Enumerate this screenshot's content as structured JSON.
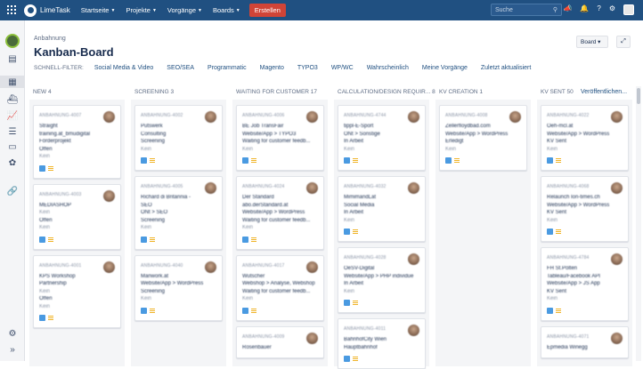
{
  "app": {
    "name": "LimeTask"
  },
  "nav": [
    {
      "label": "Startseite"
    },
    {
      "label": "Projekte"
    },
    {
      "label": "Vorgänge"
    },
    {
      "label": "Boards"
    }
  ],
  "create_label": "Erstellen",
  "search_placeholder": "Suche",
  "breadcrumb": "Anbahnung",
  "title": "Kanban-Board",
  "board_button": "Board",
  "filters": {
    "label": "SCHNELL-FILTER:",
    "items": [
      "Social Media & Video",
      "SEO/SEA",
      "Programmatic",
      "Magento",
      "TYPO3",
      "WP/WC",
      "Wahrscheinlich",
      "Meine Vorgänge",
      "Zuletzt aktualisiert"
    ]
  },
  "publish_label": "Veröffentlichen...",
  "columns": [
    {
      "name": "NEW 4",
      "cards": [
        {
          "key": "ANBAHNUNG-4007",
          "lines": [
            "Straight",
            "training.at_bmudigital",
            "Förderprojekt",
            "Offen",
            "Kein"
          ]
        },
        {
          "key": "ANBAHNUNG-4003",
          "lines": [
            "MEDIASHOP",
            "Kein",
            "Offen",
            "Kein"
          ]
        },
        {
          "key": "ANBAHNUNG-4001",
          "lines": [
            "KPS Workshop",
            "Partnership",
            "Kein",
            "Offen",
            "Kein"
          ]
        }
      ]
    },
    {
      "name": "SCREENING 3",
      "cards": [
        {
          "key": "ANBAHNUNG-4002",
          "lines": [
            "Putswerk",
            "Consulting",
            "Screening",
            "Kein"
          ]
        },
        {
          "key": "ANBAHNUNG-4005",
          "lines": [
            "Richard di Britannia -",
            "SEO",
            "ONt > SEO",
            "Screening",
            "Kein"
          ]
        },
        {
          "key": "ANBAHNUNG-4040",
          "lines": [
            "Manwork.at",
            "Website/App > WordPress",
            "Screening",
            "Kein"
          ]
        }
      ]
    },
    {
      "name": "WAITING FOR CUSTOMER 17",
      "cards": [
        {
          "key": "ANBAHNUNG-4006",
          "lines": [
            "BE Job TransFair",
            "Website/App > TYPO3",
            "Waiting for customer feedb...",
            "Kein"
          ]
        },
        {
          "key": "ANBAHNUNG-4024",
          "lines": [
            "Der Standard",
            "abo.derStandard.at",
            "Website/App > WordPress",
            "Waiting for customer feedb...",
            "Kein"
          ]
        },
        {
          "key": "ANBAHNUNG-4017",
          "lines": [
            "Wutscher",
            "Webshop > Analyse, Webshop",
            "Waiting for customer feedb...",
            "Kein"
          ]
        },
        {
          "key": "ANBAHNUNG-4009",
          "lines": [
            "Rosenbauer"
          ]
        }
      ]
    },
    {
      "name": "CALCULATION/DESIGN REQUIR... 8",
      "cards": [
        {
          "key": "ANBAHNUNG-4744",
          "lines": [
            "tippl-E-Sport",
            "ONt > Sonstige",
            "In Arbeit",
            "Kein"
          ]
        },
        {
          "key": "ANBAHNUNG-4032",
          "lines": [
            "MimimandLat",
            "Social Media",
            "In Arbeit",
            "Kein"
          ]
        },
        {
          "key": "ANBAHNUNG-4028",
          "lines": [
            "OeSV-Digital",
            "Website/App > PHP individue",
            "In Arbeit",
            "Kein"
          ]
        },
        {
          "key": "ANBAHNUNG-4011",
          "lines": [
            "BahnhofCity Wien",
            "Hauptbahnhof"
          ]
        }
      ]
    },
    {
      "name": "KV CREATION 1",
      "cards": [
        {
          "key": "ANBAHNUNG-4008",
          "lines": [
            "Zellerfloydbad.com",
            "Website/App > WordPress",
            "Erledigt",
            "Kein"
          ]
        }
      ]
    },
    {
      "name": "KV SENT 50",
      "cards": [
        {
          "key": "ANBAHNUNG-4022",
          "lines": [
            "Oeh-mcl.at",
            "Website/App > WordPress",
            "KV Sent",
            "Kein"
          ]
        },
        {
          "key": "ANBAHNUNG-4068",
          "lines": [
            "Relaunch Ion-times.ch",
            "Website/App > WordPress",
            "KV Sent",
            "Kein"
          ]
        },
        {
          "key": "ANBAHNUNG-4784",
          "lines": [
            "FH St.Pölten",
            "Tableau/Facebook API",
            "Website/App > JS App",
            "KV Sent",
            "Kein"
          ]
        },
        {
          "key": "ANBAHNUNG-4071",
          "lines": [
            "Epmedia Winegg"
          ]
        }
      ]
    }
  ]
}
